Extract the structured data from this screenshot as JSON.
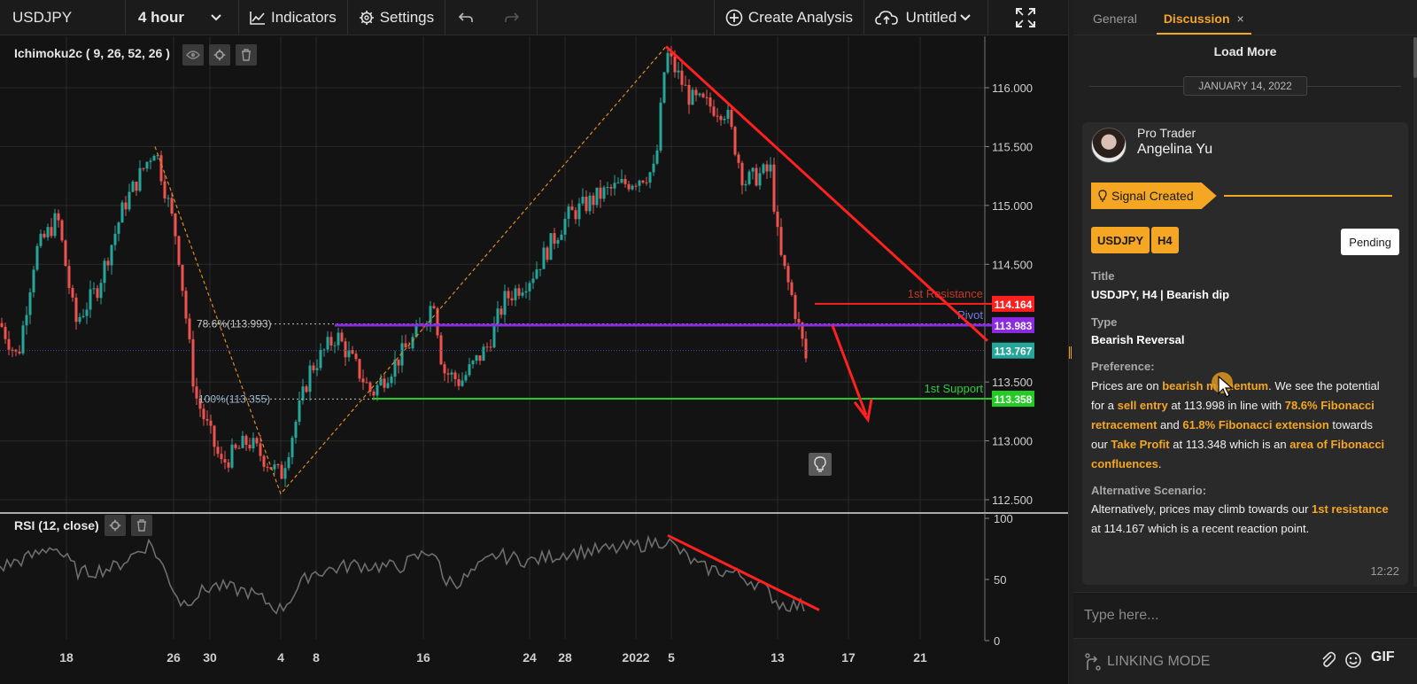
{
  "toolbar": {
    "symbol": "USDJPY",
    "interval": "4 hour",
    "indicators_label": "Indicators",
    "settings_label": "Settings",
    "create_analysis_label": "Create Analysis",
    "layout_name": "Untitled"
  },
  "chart": {
    "main_indicator_label": "Ichimoku2c ( 9, 26, 52, 26 )",
    "rsi_label": "RSI (12, close)",
    "price_ticks": [
      "116.000",
      "115.500",
      "115.000",
      "114.500",
      "113.500",
      "113.000",
      "112.500"
    ],
    "rsi_ticks": [
      "100",
      "50",
      "0"
    ],
    "date_ticks": [
      "18",
      "26",
      "30",
      "4",
      "8",
      "16",
      "24",
      "28",
      "2022",
      "5",
      "13",
      "17",
      "21"
    ],
    "price_tags": [
      {
        "value": "114.164",
        "color": "#ff2020"
      },
      {
        "value": "113.983",
        "color": "#8a2be2"
      },
      {
        "value": "113.767",
        "color": "#26a69a"
      },
      {
        "value": "113.358",
        "color": "#22cc22"
      }
    ],
    "line_labels": {
      "resistance": "1st Resistance",
      "pivot": "Pivot",
      "support": "1st Support",
      "fib_upper": "78.6%(113.993)",
      "fib_lower": "100%(113.355)"
    },
    "colors": {
      "bull": "#26a69a",
      "bear": "#ef5350",
      "resistance": "#ff2020",
      "pivot": "#8a2be2",
      "support": "#22cc22",
      "fib": "#e08a1e"
    }
  },
  "panel": {
    "tabs": [
      "General",
      "Discussion"
    ],
    "active_tab": "Discussion",
    "close_glyph": "×",
    "load_more": "Load More",
    "date_separator": "JANUARY 14, 2022",
    "message": {
      "author_role": "Pro Trader",
      "author_name": "Angelina Yu",
      "signal_label": "Signal Created",
      "symbol_tag": "USDJPY",
      "timeframe_tag": "H4",
      "status": "Pending",
      "title_label": "Title",
      "title_value": "USDJPY, H4 | Bearish dip",
      "type_label": "Type",
      "type_value": "Bearish Reversal",
      "preference_label": "Preference:",
      "preference_parts": [
        {
          "t": "Prices are on ",
          "h": false
        },
        {
          "t": "bearish momentum",
          "h": true
        },
        {
          "t": ". We see the potential for a ",
          "h": false
        },
        {
          "t": "sell entry",
          "h": true
        },
        {
          "t": " at 113.998 in line with ",
          "h": false
        },
        {
          "t": "78.6% Fibonacci retracement",
          "h": true
        },
        {
          "t": " and ",
          "h": false
        },
        {
          "t": "61.8% Fibonacci extension",
          "h": true
        },
        {
          "t": " towards our ",
          "h": false
        },
        {
          "t": "Take Profit",
          "h": true
        },
        {
          "t": " at 113.348 which is an ",
          "h": false
        },
        {
          "t": "area of Fibonacci confluences",
          "h": true
        },
        {
          "t": ".",
          "h": false
        }
      ],
      "alternative_label": "Alternative Scenario:",
      "alternative_parts": [
        {
          "t": "Alternatively, prices may climb towards our ",
          "h": false
        },
        {
          "t": "1st resistance",
          "h": true
        },
        {
          "t": " at 114.167 which is a recent reaction point.",
          "h": false
        }
      ],
      "time": "12:22"
    },
    "input_placeholder": "Type here...",
    "linking_mode": "LINKING MODE",
    "gif_label": "GIF"
  }
}
